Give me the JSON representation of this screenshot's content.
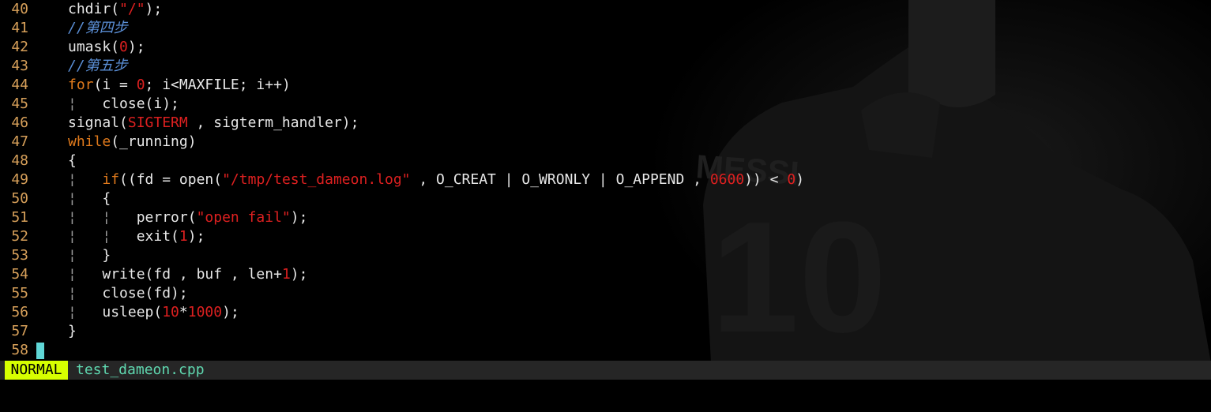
{
  "editor": {
    "lines": [
      {
        "n": "40",
        "segs": [
          {
            "t": "chdir(",
            "c": ""
          },
          {
            "t": "\"/\"",
            "c": "str"
          },
          {
            "t": ");",
            "c": ""
          }
        ]
      },
      {
        "n": "41",
        "segs": [
          {
            "t": "//第四步",
            "c": "cmt"
          }
        ]
      },
      {
        "n": "42",
        "segs": [
          {
            "t": "umask(",
            "c": ""
          },
          {
            "t": "0",
            "c": "num"
          },
          {
            "t": ");",
            "c": ""
          }
        ]
      },
      {
        "n": "43",
        "segs": [
          {
            "t": "//第五步",
            "c": "cmt"
          }
        ]
      },
      {
        "n": "44",
        "segs": [
          {
            "t": "for",
            "c": "kw"
          },
          {
            "t": "(i = ",
            "c": ""
          },
          {
            "t": "0",
            "c": "num"
          },
          {
            "t": "; i<MAXFILE; i++)",
            "c": ""
          }
        ]
      },
      {
        "n": "45",
        "segs": [
          {
            "t": "¦   ",
            "c": "guide"
          },
          {
            "t": "close(i);",
            "c": ""
          }
        ]
      },
      {
        "n": "46",
        "segs": [
          {
            "t": "signal(",
            "c": ""
          },
          {
            "t": "SIGTERM",
            "c": "str"
          },
          {
            "t": " , sigterm_handler);",
            "c": ""
          }
        ]
      },
      {
        "n": "47",
        "segs": [
          {
            "t": "while",
            "c": "kw"
          },
          {
            "t": "(_running)",
            "c": ""
          }
        ]
      },
      {
        "n": "48",
        "segs": [
          {
            "t": "{",
            "c": ""
          }
        ]
      },
      {
        "n": "49",
        "segs": [
          {
            "t": "¦   ",
            "c": "guide"
          },
          {
            "t": "if",
            "c": "kw"
          },
          {
            "t": "((fd = open(",
            "c": ""
          },
          {
            "t": "\"/tmp/test_dameon.log\"",
            "c": "str"
          },
          {
            "t": " , O_CREAT | O_WRONLY | O_APPEND , ",
            "c": ""
          },
          {
            "t": "0600",
            "c": "num"
          },
          {
            "t": ")) < ",
            "c": ""
          },
          {
            "t": "0",
            "c": "num"
          },
          {
            "t": ")",
            "c": ""
          }
        ]
      },
      {
        "n": "50",
        "segs": [
          {
            "t": "¦   ",
            "c": "guide"
          },
          {
            "t": "{",
            "c": ""
          }
        ]
      },
      {
        "n": "51",
        "segs": [
          {
            "t": "¦   ¦   ",
            "c": "guide"
          },
          {
            "t": "perror(",
            "c": ""
          },
          {
            "t": "\"open fail\"",
            "c": "str"
          },
          {
            "t": ");",
            "c": ""
          }
        ]
      },
      {
        "n": "52",
        "segs": [
          {
            "t": "¦   ¦   ",
            "c": "guide"
          },
          {
            "t": "exit(",
            "c": ""
          },
          {
            "t": "1",
            "c": "num"
          },
          {
            "t": ");",
            "c": ""
          }
        ]
      },
      {
        "n": "53",
        "segs": [
          {
            "t": "¦   ",
            "c": "guide"
          },
          {
            "t": "}",
            "c": ""
          }
        ]
      },
      {
        "n": "54",
        "segs": [
          {
            "t": "¦   ",
            "c": "guide"
          },
          {
            "t": "write(fd , buf , len+",
            "c": ""
          },
          {
            "t": "1",
            "c": "num"
          },
          {
            "t": ");",
            "c": ""
          }
        ]
      },
      {
        "n": "55",
        "segs": [
          {
            "t": "¦   ",
            "c": "guide"
          },
          {
            "t": "close(fd);",
            "c": ""
          }
        ]
      },
      {
        "n": "56",
        "segs": [
          {
            "t": "¦   ",
            "c": "guide"
          },
          {
            "t": "usleep(",
            "c": ""
          },
          {
            "t": "10",
            "c": "num"
          },
          {
            "t": "*",
            "c": ""
          },
          {
            "t": "1000",
            "c": "num"
          },
          {
            "t": ");",
            "c": ""
          }
        ]
      },
      {
        "n": "57",
        "segs": [
          {
            "t": "}",
            "c": ""
          }
        ]
      },
      {
        "n": "58",
        "segs": []
      }
    ],
    "cursor_line": "58"
  },
  "statusbar": {
    "mode": "NORMAL",
    "filename": "test_dameon.cpp"
  },
  "colors": {
    "background": "#000000",
    "line_number": "#d7a05a",
    "keyword": "#e07a1c",
    "string": "#dd2020",
    "comment": "#5b8fd6",
    "mode_badge": "#d7ff00",
    "filename": "#5fd7af",
    "cursor": "#5fd6d6"
  }
}
